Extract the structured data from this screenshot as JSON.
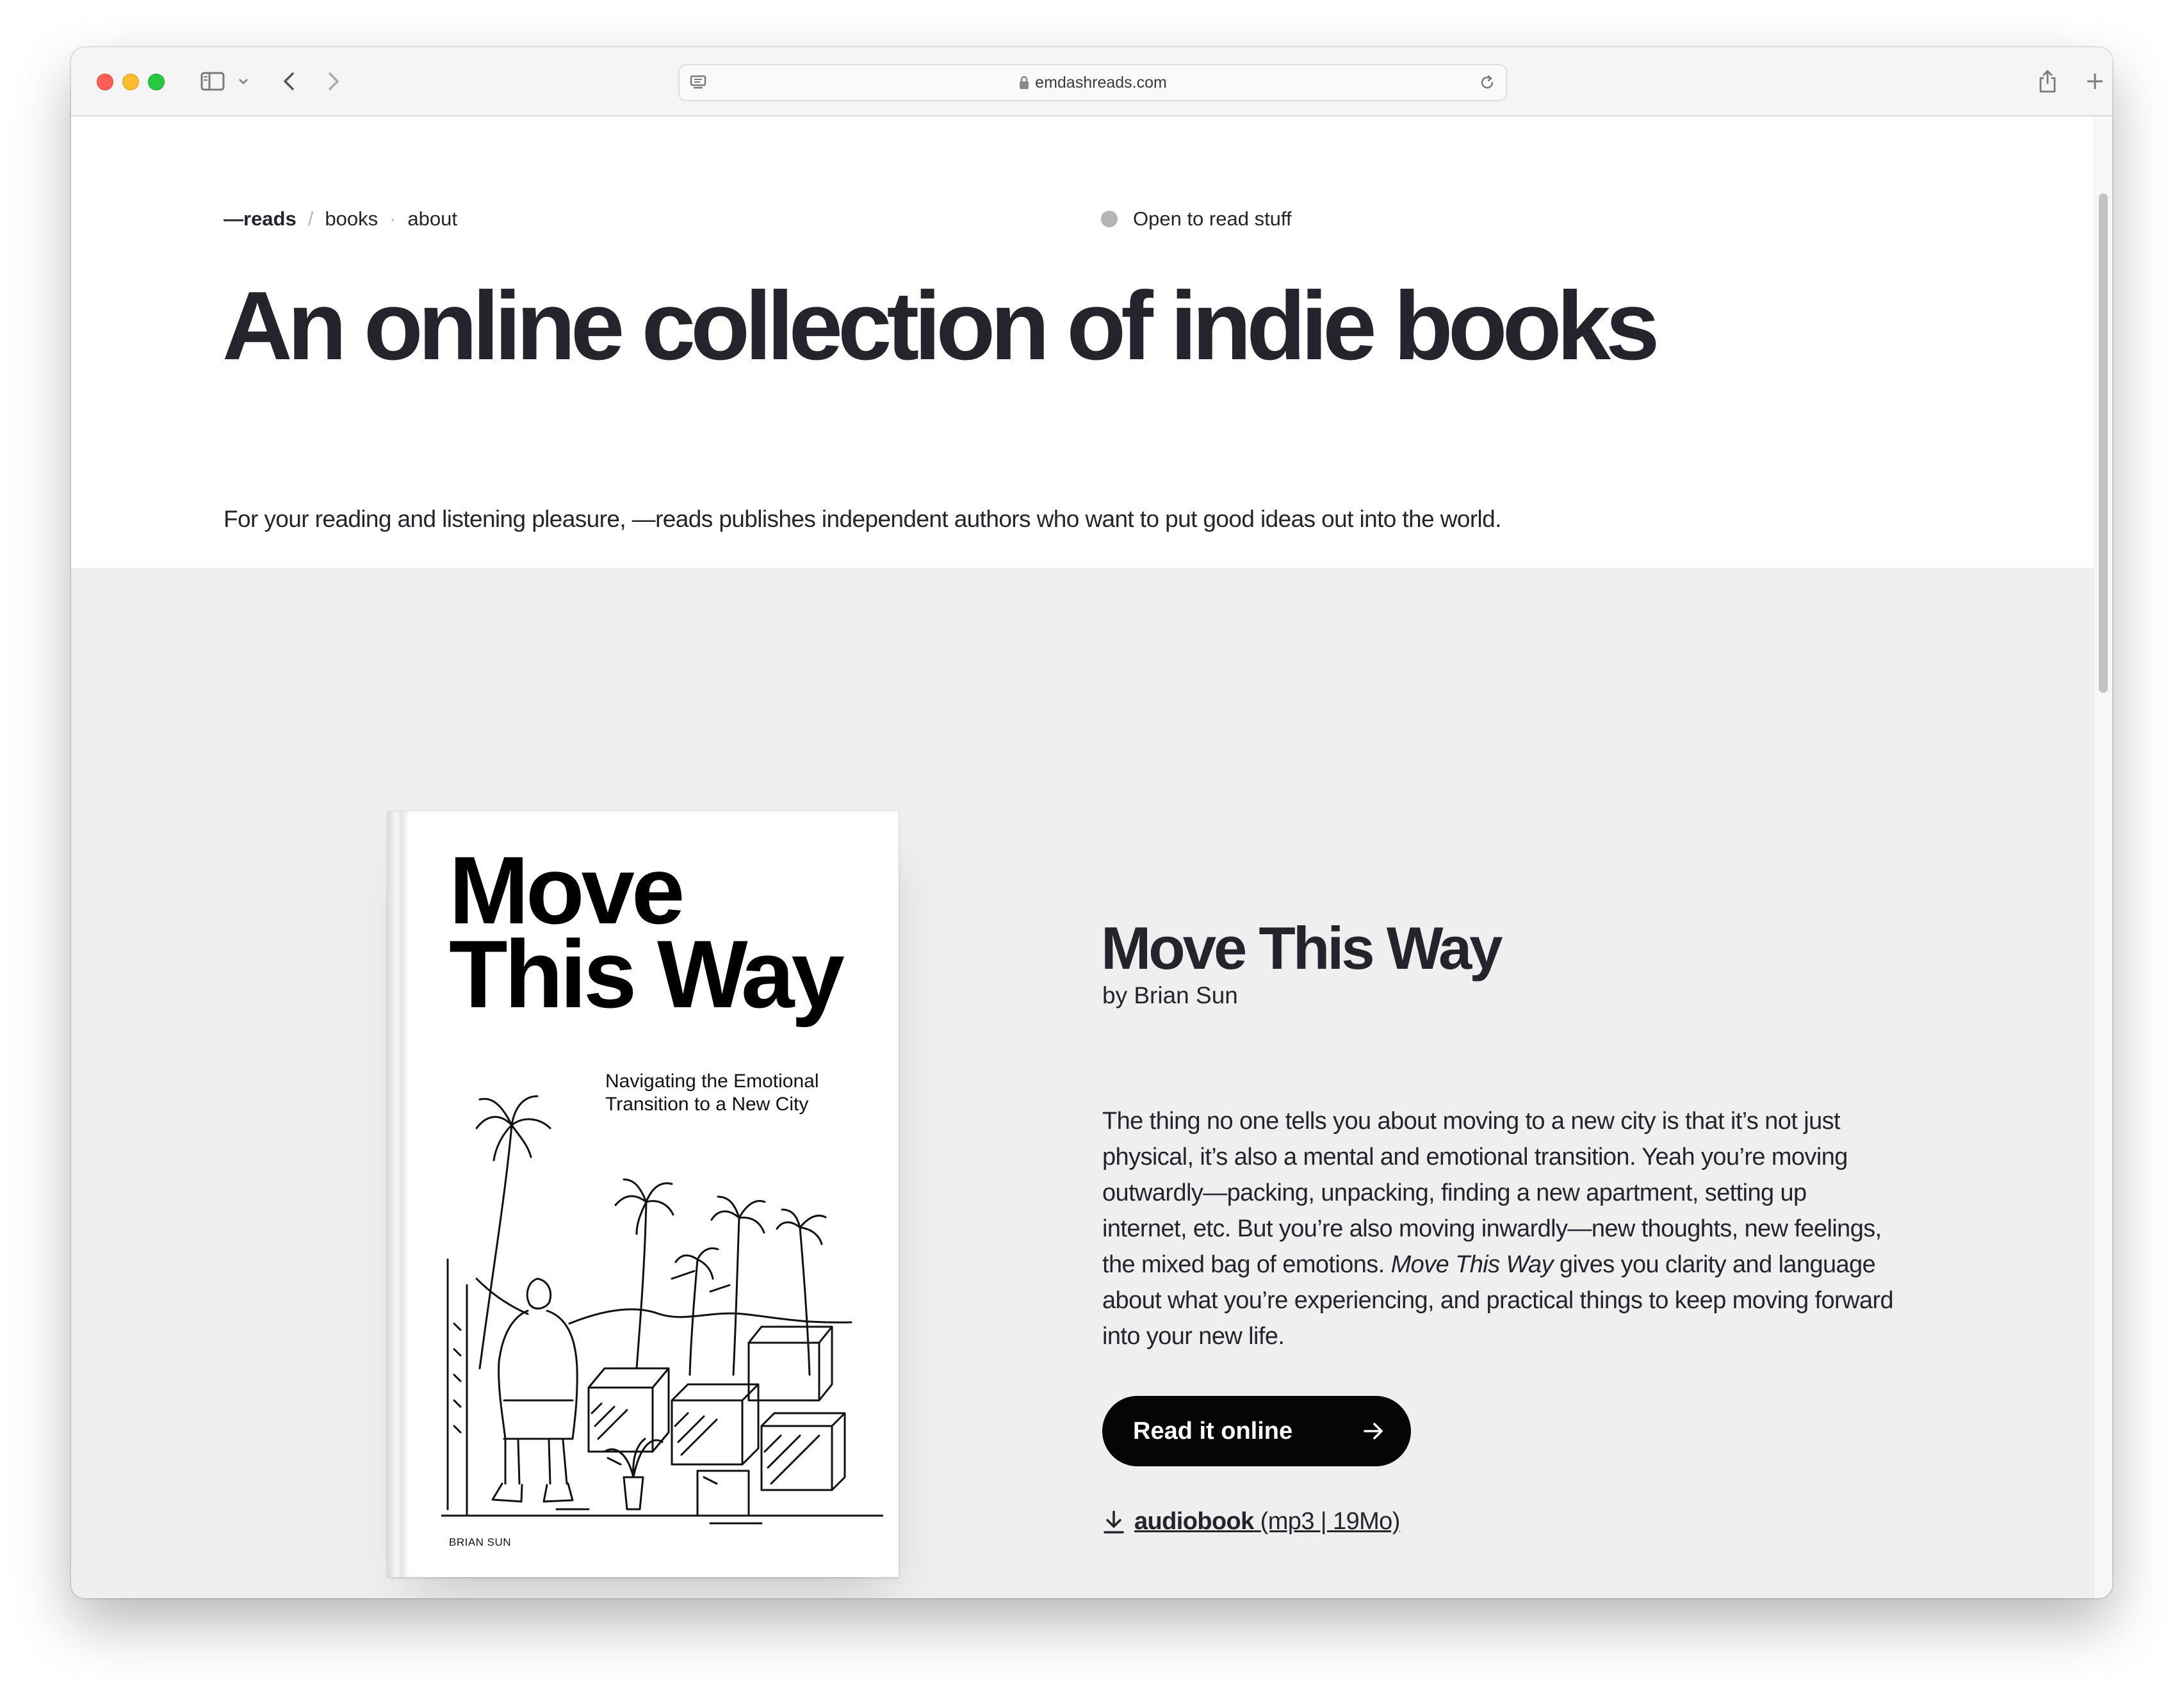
{
  "browser": {
    "url": "emdashreads.com"
  },
  "nav": {
    "brand": "—reads",
    "separator": "/",
    "dot_separator": "·",
    "items": [
      {
        "label": "books"
      },
      {
        "label": "about"
      }
    ],
    "status": "Open to read stuff"
  },
  "hero": {
    "title": "An online collection of indie books",
    "subtitle": "For your reading and listening pleasure, —reads publishes independent authors who want to put good ideas out into the world."
  },
  "book": {
    "cover": {
      "title_line1": "Move",
      "title_line2": "This Way",
      "subtitle": "Navigating the Emotional Transition to a New City",
      "author": "BRIAN SUN"
    },
    "title": "Move This Way",
    "byline": "by Brian Sun",
    "description": {
      "before": "The thing no one tells you about moving to a new city is that it’s not just physical, it’s also a mental and emotional transition. Yeah you’re moving outwardly—packing, unpacking, finding a new apartment, setting up internet, etc. But you’re also moving inwardly—new thoughts, new feelings, the mixed bag of emotions. ",
      "italic": "Move This Way",
      "after": " gives you clarity and language about what you’re experiencing, and practical things to keep moving forward into your new life."
    },
    "read_button": "Read it online",
    "audiobook": {
      "label": "audiobook",
      "meta": "(mp3 | 19Mo)"
    }
  },
  "colors": {
    "text": "#25242c",
    "feature_bg": "#efefef",
    "button_bg": "#050505",
    "status_dot": "#b4b4b4"
  },
  "icons": [
    "sidebar-icon",
    "chevron-down-icon",
    "back-icon",
    "forward-icon",
    "reader-icon",
    "lock-icon",
    "reload-icon",
    "share-icon",
    "plus-icon",
    "tabs-icon",
    "arrow-right-icon",
    "download-icon"
  ]
}
